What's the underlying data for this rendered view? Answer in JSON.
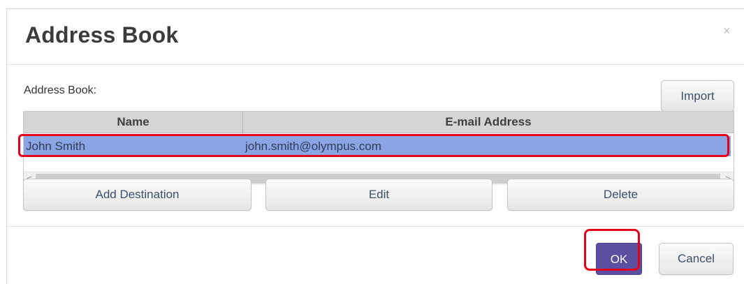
{
  "dialog": {
    "title": "Address Book",
    "close_glyph": "×"
  },
  "address_book": {
    "label": "Address Book:",
    "import_label": "Import",
    "columns": [
      "Name",
      "E-mail Address"
    ],
    "rows": [
      {
        "name": "John Smith",
        "email": "john.smith@olympus.com",
        "selected": true
      }
    ],
    "scroll_left_glyph": "<",
    "scroll_right_glyph": ">"
  },
  "actions": {
    "add_label": "Add Destination",
    "edit_label": "Edit",
    "delete_label": "Delete"
  },
  "footer": {
    "ok_label": "OK",
    "cancel_label": "Cancel"
  },
  "colors": {
    "selected_row": "#8aa4e4",
    "primary_button": "#5a4fa0",
    "highlight": "#e3001b"
  }
}
